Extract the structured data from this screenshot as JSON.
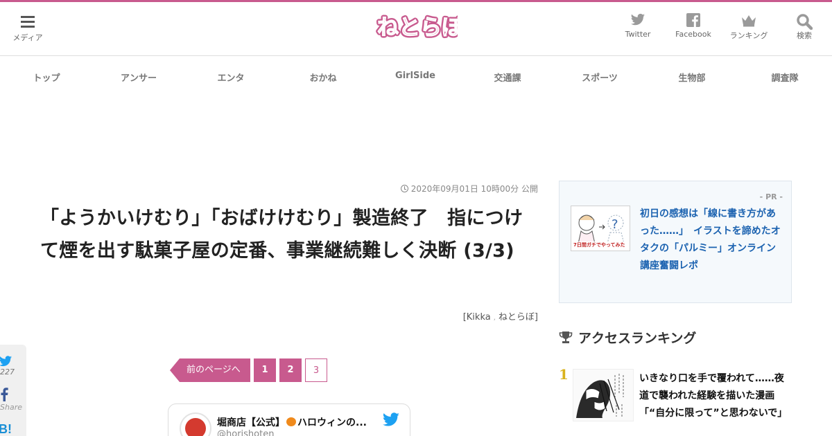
{
  "colors": {
    "accent": "#c85a8e",
    "link": "#1b62b0",
    "twitter": "#1da1f2",
    "icon_gray": "#9a9a9a",
    "rank_gold": "#d9b21c"
  },
  "header": {
    "menu_label": "メディア",
    "logo_text": "ねとらぼ",
    "icons": [
      {
        "name": "twitter-icon",
        "label": "Twitter"
      },
      {
        "name": "facebook-icon",
        "label": "Facebook"
      },
      {
        "name": "crown-icon",
        "label": "ランキング"
      },
      {
        "name": "search-icon",
        "label": "検索"
      }
    ]
  },
  "nav": {
    "items": [
      "トップ",
      "アンサー",
      "エンタ",
      "おかね",
      "GirlSide",
      "交通課",
      "スポーツ",
      "生物部",
      "調査隊"
    ]
  },
  "article": {
    "date": "2020年09月01日 10時00分 公開",
    "title": "「ようかいけむり」「おばけけむり」製造終了　指につけて煙を出す駄菓子屋の定番、事業継続難しく決断 (3/3)",
    "byline_open": "[",
    "author": "Kikka",
    "byline_sep": ",",
    "publisher": "ねとらぼ",
    "byline_close": "]"
  },
  "pager": {
    "prev_label": "前のページへ",
    "pages": [
      "1",
      "2",
      "3"
    ],
    "current": "3"
  },
  "tweet_embed": {
    "name_prefix": "堀商店【公式】",
    "name_suffix": "ハロウィンの...",
    "handle": "@horishoten"
  },
  "share_bar": {
    "twitter_count": "227",
    "facebook_label": "Share",
    "hatena_label": "B!"
  },
  "sidebar": {
    "pr_label": "- PR -",
    "pr_thumb_caption": "7日間ガチでやってみた",
    "pr_text": "初日の感想は「線に書き方があった……」　イラストを諦めたオタクの「パルミー」オンライン講座奮闘レポ",
    "ranking_heading": "アクセスランキング",
    "ranking": [
      {
        "rank": "1",
        "text": "いきなり口を手で覆われて……夜道で襲われた経験を描いた漫画「“自分に限って”と思わないで」"
      }
    ]
  }
}
